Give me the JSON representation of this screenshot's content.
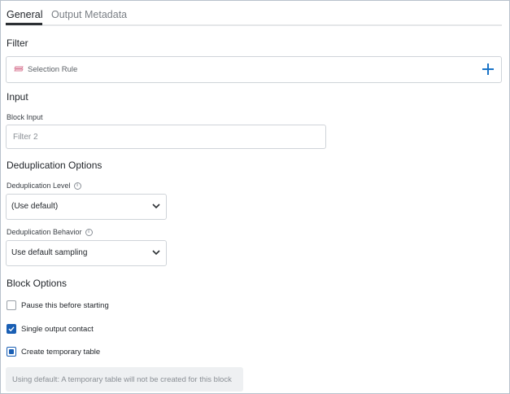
{
  "tabs": [
    {
      "label": "General",
      "active": true
    },
    {
      "label": "Output Metadata",
      "active": false
    }
  ],
  "filter": {
    "title": "Filter",
    "rule_label": "Selection Rule",
    "rule_icon": "selection-rule-icon",
    "add_icon": "plus-icon",
    "accent_color": "#1a74c7"
  },
  "input": {
    "title": "Input",
    "block_input_label": "Block Input",
    "block_input_value": "Filter 2"
  },
  "dedup": {
    "title": "Deduplication Options",
    "level_label": "Deduplication Level",
    "level_value": "(Use default)",
    "behavior_label": "Deduplication Behavior",
    "behavior_value": "Use default sampling"
  },
  "block_options": {
    "title": "Block Options",
    "items": [
      {
        "label": "Pause this before starting",
        "state": "unchecked"
      },
      {
        "label": "Single output contact",
        "state": "checked"
      },
      {
        "label": "Create temporary table",
        "state": "partial"
      }
    ],
    "note": "Using default: A temporary table will not be created for this block"
  }
}
